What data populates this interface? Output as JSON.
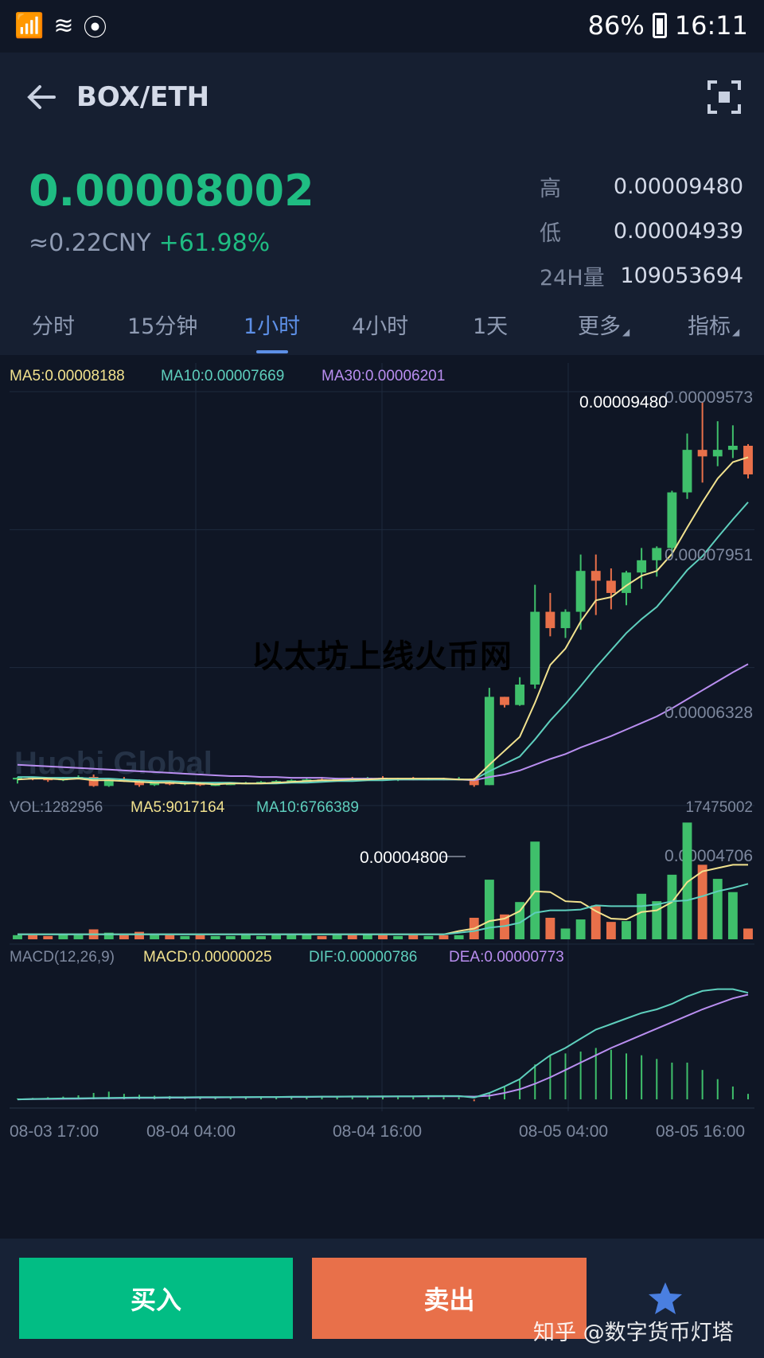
{
  "statusbar": {
    "battery": "86%",
    "time": "16:11"
  },
  "header": {
    "title": "BOX/ETH"
  },
  "summary": {
    "last_price": "0.00008002",
    "cny": "≈0.22CNY",
    "change": "+61.98%",
    "stats": [
      {
        "label": "高",
        "value": "0.00009480"
      },
      {
        "label": "低",
        "value": "0.00004939"
      },
      {
        "label": "24H量",
        "value": "109053694"
      }
    ]
  },
  "tabs": [
    {
      "label": "分时"
    },
    {
      "label": "15分钟"
    },
    {
      "label": "1小时"
    },
    {
      "label": "4小时"
    },
    {
      "label": "1天"
    },
    {
      "label": "更多"
    },
    {
      "label": "指标"
    }
  ],
  "active_tab_index": 2,
  "chart_data": {
    "type": "candlestick",
    "ma_legend": {
      "ma5": "MA5:0.00008188",
      "ma10": "MA10:0.00007669",
      "ma30": "MA30:0.00006201"
    },
    "price_axis_labels": [
      "0.00009573",
      "0.00007951",
      "0.00006328",
      "0.00004706"
    ],
    "price_range": [
      4.706e-05,
      9.573e-05
    ],
    "high_marker": "0.00009480",
    "low_marker": "0.00004800",
    "watermark": "Huobi Global",
    "candles": [
      [
        4.87,
        4.9,
        4.82,
        4.89
      ],
      [
        4.89,
        4.9,
        4.86,
        4.88
      ],
      [
        4.88,
        4.89,
        4.84,
        4.86
      ],
      [
        4.86,
        4.9,
        4.85,
        4.89
      ],
      [
        4.89,
        4.92,
        4.88,
        4.9
      ],
      [
        4.9,
        4.93,
        4.78,
        4.79
      ],
      [
        4.79,
        4.88,
        4.78,
        4.87
      ],
      [
        4.87,
        4.9,
        4.84,
        4.85
      ],
      [
        4.85,
        4.87,
        4.78,
        4.8
      ],
      [
        4.8,
        4.84,
        4.79,
        4.83
      ],
      [
        4.83,
        4.85,
        4.8,
        4.81
      ],
      [
        4.81,
        4.84,
        4.8,
        4.83
      ],
      [
        4.83,
        4.84,
        4.79,
        4.8
      ],
      [
        4.8,
        4.82,
        4.79,
        4.81
      ],
      [
        4.81,
        4.83,
        4.8,
        4.82
      ],
      [
        4.82,
        4.84,
        4.81,
        4.83
      ],
      [
        4.83,
        4.85,
        4.82,
        4.84
      ],
      [
        4.84,
        4.86,
        4.83,
        4.85
      ],
      [
        4.85,
        4.87,
        4.84,
        4.86
      ],
      [
        4.86,
        4.88,
        4.85,
        4.87
      ],
      [
        4.87,
        4.9,
        4.85,
        4.86
      ],
      [
        4.86,
        4.89,
        4.85,
        4.88
      ],
      [
        4.88,
        4.9,
        4.86,
        4.87
      ],
      [
        4.87,
        4.9,
        4.86,
        4.89
      ],
      [
        4.89,
        4.91,
        4.86,
        4.87
      ],
      [
        4.87,
        4.89,
        4.85,
        4.88
      ],
      [
        4.88,
        4.9,
        4.86,
        4.87
      ],
      [
        4.87,
        4.89,
        4.86,
        4.88
      ],
      [
        4.88,
        4.89,
        4.86,
        4.87
      ],
      [
        4.87,
        4.9,
        4.86,
        4.88
      ],
      [
        4.88,
        4.89,
        4.78,
        4.8
      ],
      [
        4.8,
        5.99,
        4.8,
        5.88
      ],
      [
        5.88,
        5.88,
        5.75,
        5.78
      ],
      [
        5.78,
        6.12,
        5.77,
        6.03
      ],
      [
        6.03,
        7.25,
        5.98,
        6.92
      ],
      [
        6.92,
        7.15,
        6.62,
        6.72
      ],
      [
        6.72,
        6.95,
        6.6,
        6.92
      ],
      [
        6.92,
        7.62,
        6.7,
        7.42
      ],
      [
        7.42,
        7.62,
        6.88,
        7.3
      ],
      [
        7.3,
        7.45,
        6.95,
        7.15
      ],
      [
        7.15,
        7.42,
        7.0,
        7.4
      ],
      [
        7.4,
        7.7,
        7.2,
        7.55
      ],
      [
        7.55,
        7.72,
        7.35,
        7.7
      ],
      [
        7.7,
        8.4,
        7.6,
        8.38
      ],
      [
        8.38,
        9.1,
        8.3,
        8.9
      ],
      [
        8.9,
        9.48,
        8.5,
        8.82
      ],
      [
        8.82,
        9.25,
        8.7,
        8.9
      ],
      [
        8.9,
        9.2,
        8.8,
        8.95
      ],
      [
        8.95,
        8.97,
        8.55,
        8.6
      ]
    ],
    "ma5": [
      4.87,
      4.88,
      4.88,
      4.87,
      4.88,
      4.86,
      4.86,
      4.85,
      4.84,
      4.83,
      4.83,
      4.82,
      4.82,
      4.81,
      4.82,
      4.82,
      4.82,
      4.83,
      4.84,
      4.85,
      4.86,
      4.86,
      4.87,
      4.87,
      4.88,
      4.88,
      4.88,
      4.88,
      4.88,
      4.87,
      4.87,
      5.05,
      5.22,
      5.39,
      5.81,
      6.27,
      6.47,
      6.8,
      7.06,
      7.1,
      7.24,
      7.36,
      7.42,
      7.63,
      7.95,
      8.26,
      8.55,
      8.75,
      8.81
    ],
    "ma10": [
      4.9,
      4.9,
      4.89,
      4.89,
      4.89,
      4.88,
      4.88,
      4.87,
      4.86,
      4.85,
      4.85,
      4.84,
      4.83,
      4.83,
      4.83,
      4.82,
      4.82,
      4.82,
      4.83,
      4.83,
      4.84,
      4.85,
      4.85,
      4.86,
      4.86,
      4.87,
      4.87,
      4.87,
      4.87,
      4.87,
      4.87,
      4.97,
      5.06,
      5.15,
      5.36,
      5.59,
      5.79,
      6.01,
      6.24,
      6.45,
      6.66,
      6.83,
      6.98,
      7.2,
      7.43,
      7.6,
      7.83,
      8.05,
      8.26
    ],
    "ma30": [
      5.05,
      5.04,
      5.03,
      5.02,
      5.01,
      5.0,
      4.99,
      4.98,
      4.97,
      4.96,
      4.95,
      4.94,
      4.93,
      4.92,
      4.91,
      4.91,
      4.9,
      4.9,
      4.89,
      4.89,
      4.89,
      4.88,
      4.88,
      4.88,
      4.88,
      4.87,
      4.87,
      4.87,
      4.87,
      4.87,
      4.86,
      4.9,
      4.93,
      4.98,
      5.05,
      5.12,
      5.18,
      5.26,
      5.33,
      5.4,
      5.48,
      5.56,
      5.64,
      5.74,
      5.85,
      5.96,
      6.07,
      6.18,
      6.28
    ],
    "vol_legend": {
      "vol": "VOL:1282956",
      "ma5": "MA5:9017164",
      "ma10": "MA10:6766389"
    },
    "vol_max_label": "17475002",
    "volume": [
      0.5,
      0.5,
      0.4,
      0.6,
      0.5,
      1.2,
      0.8,
      0.5,
      0.9,
      0.5,
      0.5,
      0.4,
      0.5,
      0.4,
      0.4,
      0.5,
      0.4,
      0.5,
      0.5,
      0.6,
      0.4,
      0.5,
      0.5,
      0.6,
      0.5,
      0.4,
      0.5,
      0.4,
      0.5,
      0.5,
      2.6,
      7.2,
      3.0,
      4.5,
      11.8,
      2.6,
      1.3,
      2.4,
      4.1,
      2.1,
      2.2,
      5.5,
      4.6,
      7.8,
      14.1,
      9.0,
      7.3,
      5.7,
      1.3
    ],
    "vol_ma5": [
      0.6,
      0.6,
      0.6,
      0.6,
      0.6,
      0.6,
      0.6,
      0.6,
      0.6,
      0.6,
      0.6,
      0.6,
      0.6,
      0.6,
      0.6,
      0.6,
      0.6,
      0.6,
      0.6,
      0.6,
      0.6,
      0.6,
      0.6,
      0.6,
      0.6,
      0.6,
      0.6,
      0.6,
      0.6,
      1.0,
      1.3,
      2.2,
      2.5,
      3.4,
      5.8,
      5.7,
      4.6,
      4.5,
      3.4,
      2.5,
      2.4,
      3.3,
      3.5,
      4.5,
      6.9,
      8.2,
      8.6,
      9.0,
      9.0
    ],
    "vol_ma10": [
      0.6,
      0.6,
      0.6,
      0.6,
      0.6,
      0.6,
      0.6,
      0.6,
      0.6,
      0.6,
      0.6,
      0.6,
      0.6,
      0.6,
      0.6,
      0.6,
      0.6,
      0.6,
      0.6,
      0.6,
      0.6,
      0.6,
      0.6,
      0.6,
      0.6,
      0.6,
      0.6,
      0.6,
      0.6,
      0.8,
      1.0,
      1.4,
      1.6,
      2.0,
      3.2,
      3.5,
      3.5,
      3.6,
      4.1,
      4.0,
      4.0,
      4.0,
      4.2,
      4.6,
      4.7,
      5.2,
      5.8,
      6.2,
      6.7
    ],
    "macd_legend": {
      "title": "MACD(12,26,9)",
      "macd": "MACD:0.00000025",
      "dif": "DIF:0.00000786",
      "dea": "DEA:0.00000773"
    },
    "dif": [
      0.0,
      0.02,
      0.04,
      0.05,
      0.06,
      0.07,
      0.08,
      0.09,
      0.1,
      0.1,
      0.11,
      0.11,
      0.12,
      0.12,
      0.12,
      0.13,
      0.13,
      0.13,
      0.14,
      0.14,
      0.15,
      0.15,
      0.16,
      0.16,
      0.17,
      0.17,
      0.17,
      0.18,
      0.18,
      0.18,
      0.1,
      0.35,
      0.7,
      1.1,
      1.8,
      2.4,
      2.8,
      3.3,
      3.8,
      4.1,
      4.4,
      4.7,
      4.9,
      5.2,
      5.6,
      5.9,
      6.0,
      6.0,
      5.8
    ],
    "dea": [
      0.0,
      0.01,
      0.02,
      0.03,
      0.04,
      0.05,
      0.06,
      0.07,
      0.08,
      0.08,
      0.09,
      0.09,
      0.1,
      0.1,
      0.11,
      0.11,
      0.12,
      0.12,
      0.13,
      0.13,
      0.14,
      0.14,
      0.15,
      0.15,
      0.15,
      0.16,
      0.16,
      0.16,
      0.17,
      0.17,
      0.15,
      0.2,
      0.35,
      0.55,
      0.85,
      1.2,
      1.6,
      2.0,
      2.4,
      2.8,
      3.15,
      3.5,
      3.85,
      4.2,
      4.55,
      4.9,
      5.2,
      5.5,
      5.7
    ],
    "macd_hist": [
      0.05,
      0.08,
      0.12,
      0.15,
      0.22,
      0.35,
      0.42,
      0.3,
      0.25,
      0.2,
      0.18,
      0.16,
      0.14,
      0.12,
      0.12,
      0.13,
      0.12,
      0.12,
      0.12,
      0.12,
      0.12,
      0.12,
      0.12,
      0.12,
      0.12,
      0.12,
      0.12,
      0.12,
      0.12,
      0.12,
      -0.1,
      0.3,
      0.7,
      1.1,
      1.9,
      2.4,
      2.5,
      2.6,
      2.8,
      2.7,
      2.5,
      2.4,
      2.2,
      2.0,
      2.0,
      1.6,
      1.1,
      0.7,
      0.3
    ],
    "x_labels": [
      "08-03 17:00",
      "08-04 04:00",
      "08-04 16:00",
      "08-05 04:00",
      "08-05 16:00"
    ]
  },
  "overlay_caption": "以太坊上线火币网",
  "bottom": {
    "buy": "买入",
    "sell": "卖出",
    "watermark": "知乎 @数字货币灯塔"
  },
  "colors": {
    "up": "#3fbf6b",
    "down": "#e8704a",
    "ma5": "#f2e28e",
    "ma10": "#5ecfbd",
    "ma30": "#b98ef0",
    "accent": "#5d8fe6"
  }
}
